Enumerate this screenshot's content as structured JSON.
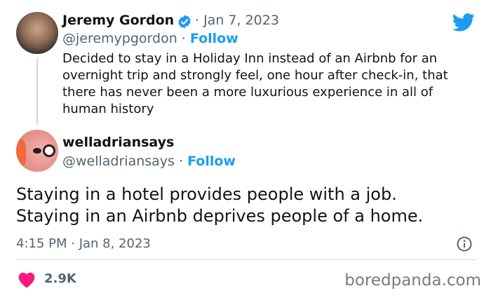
{
  "tweet": {
    "author_name": "Jeremy Gordon",
    "date": "· Jan 7, 2023",
    "handle": "@jeremypgordon",
    "separator": " · ",
    "follow_label": "Follow",
    "text_lines": [
      "Decided to stay in a Holiday Inn instead of an Airbnb for an",
      "overnight trip and strongly feel, one hour after check-in, that",
      "there has never been a more luxurious experience in all of",
      "human history"
    ]
  },
  "reply": {
    "author_name": "welladriansays",
    "handle": "@welladriansays",
    "separator": " · ",
    "follow_label": "Follow",
    "text_lines": [
      "Staying in a hotel provides people with a job.",
      "Staying in an Airbnb deprives people of a home."
    ],
    "timestamp": "4:15 PM · Jan 8, 2023",
    "likes": "2.9K"
  },
  "watermark": "boredpanda.com",
  "icons": {
    "verified": "verified-badge-icon",
    "twitter": "twitter-bird-icon",
    "info": "info-icon",
    "heart": "heart-icon"
  },
  "colors": {
    "accent": "#1d9bf0",
    "heart": "#f91880",
    "muted": "#536471"
  }
}
